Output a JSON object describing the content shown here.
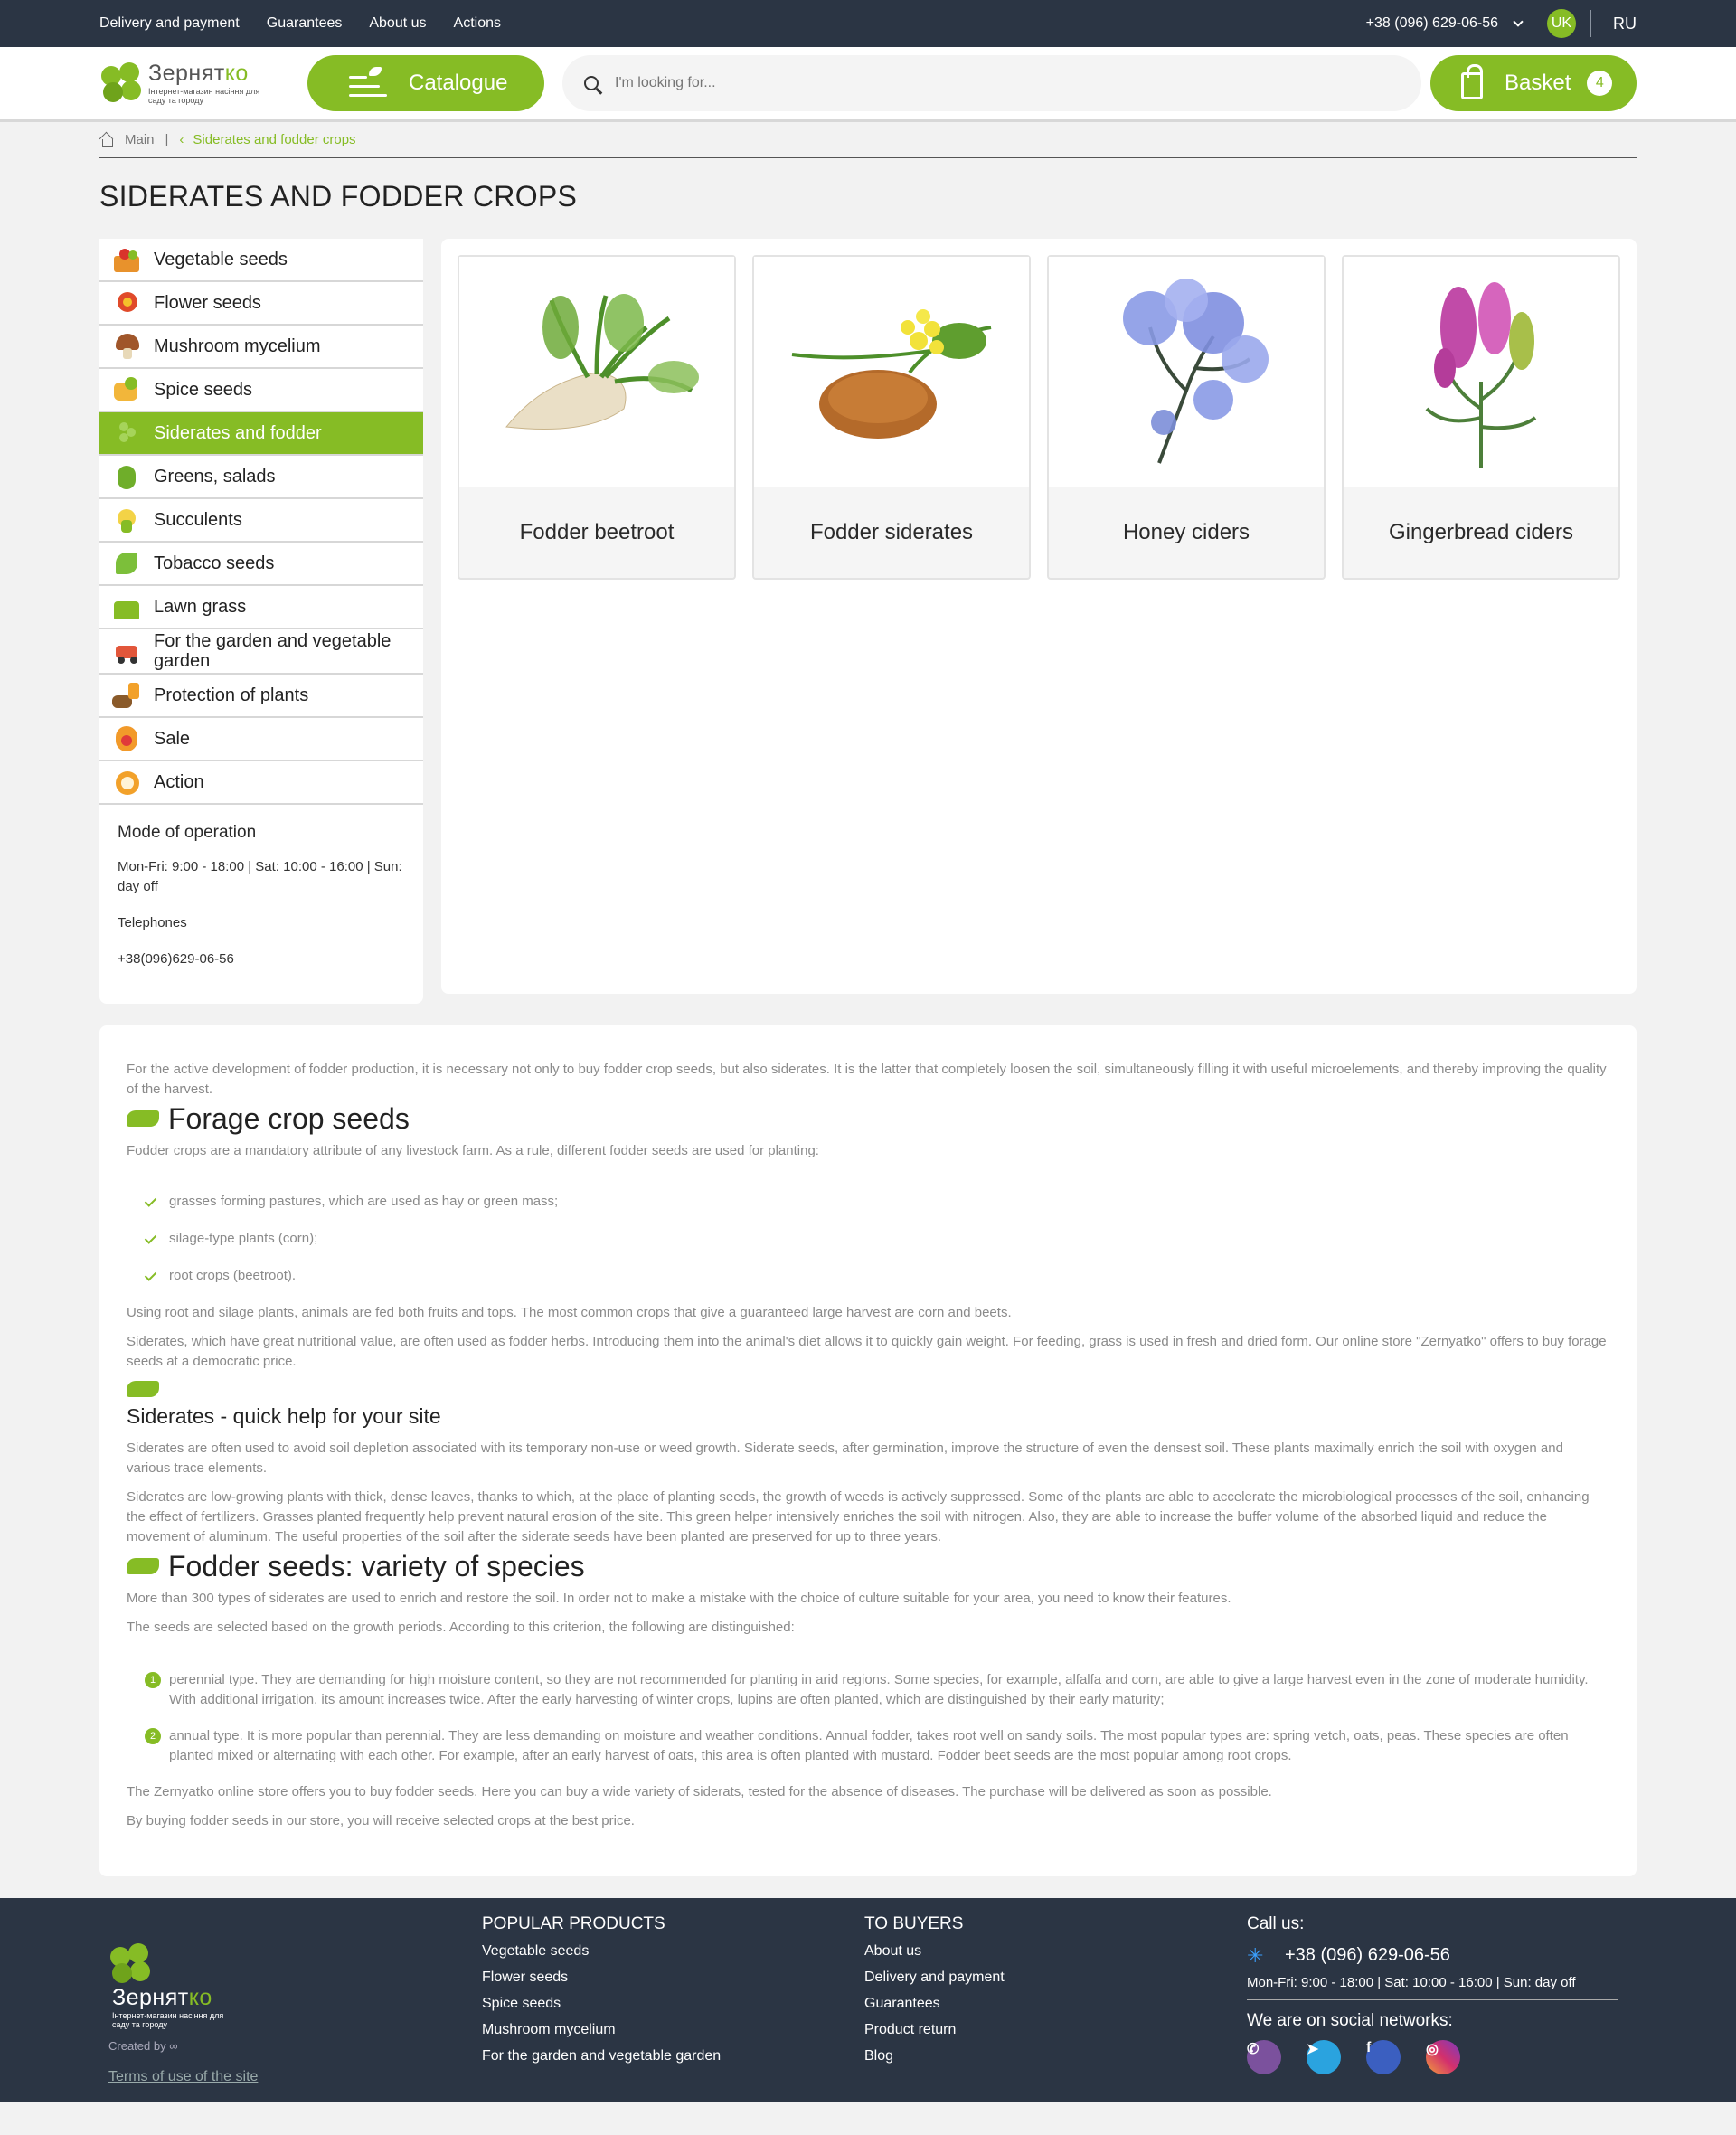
{
  "topbar": {
    "nav": [
      "Delivery and payment",
      "Guarantees",
      "About us",
      "Actions"
    ],
    "phone": "+38 (096) 629-06-56",
    "lang_active": "UK",
    "lang_other": "RU"
  },
  "header": {
    "logo_name": "Зернят",
    "logo_name_accent": "ко",
    "logo_sub": "Інтернет-магазин насіння для саду та городу",
    "catalogue": "Catalogue",
    "search_placeholder": "I'm looking for...",
    "basket": "Basket",
    "basket_count": "4"
  },
  "breadcrumb": {
    "home": "Main",
    "current": "Siderates and fodder crops"
  },
  "page_title": "SIDERATES AND FODDER CROPS",
  "sidebar": {
    "categories": [
      {
        "label": "Vegetable seeds",
        "icon": "vegetable-basket-icon"
      },
      {
        "label": "Flower seeds",
        "icon": "flower-icon"
      },
      {
        "label": "Mushroom mycelium",
        "icon": "mushroom-icon"
      },
      {
        "label": "Spice seeds",
        "icon": "spice-icon"
      },
      {
        "label": "Siderates and fodder",
        "icon": "clover-icon",
        "active": true
      },
      {
        "label": "Greens, salads",
        "icon": "greens-icon"
      },
      {
        "label": "Succulents",
        "icon": "succulent-icon"
      },
      {
        "label": "Tobacco seeds",
        "icon": "tobacco-leaf-icon"
      },
      {
        "label": "Lawn grass",
        "icon": "grass-icon"
      },
      {
        "label": "For the garden and vegetable garden",
        "icon": "lawnmower-icon"
      },
      {
        "label": "Protection of plants",
        "icon": "sprayer-icon"
      },
      {
        "label": "Sale",
        "icon": "sale-icon"
      },
      {
        "label": "Action",
        "icon": "action-badge-icon"
      }
    ],
    "mode_title": "Mode of operation",
    "mode_text": "Mon-Fri: 9:00 - 18:00 | Sat: 10:00 - 16:00 | Sun: day off",
    "phones_title": "Telephones",
    "phone": "+38(096)629-06-56"
  },
  "products": [
    {
      "title": "Fodder beetroot"
    },
    {
      "title": "Fodder siderates"
    },
    {
      "title": "Honey ciders"
    },
    {
      "title": "Gingerbread ciders"
    }
  ],
  "seo": {
    "intro": "For the active development of fodder production, it is necessary not only to buy fodder crop seeds, but also siderates. It is the latter that completely loosen the soil, simultaneously filling it with useful microelements, and thereby improving the quality of the harvest.",
    "h2_1": "Forage crop seeds",
    "p1": "Fodder crops are a mandatory attribute of any livestock farm. As a rule, different fodder seeds are used for planting:",
    "checks": [
      "grasses forming pastures, which are used as hay or green mass;",
      "silage-type plants (corn);",
      "root crops (beetroot)."
    ],
    "p2": "Using root and silage plants, animals are fed both fruits and tops. The most common crops that give a guaranteed large harvest are corn and beets.",
    "p3": "Siderates, which have great nutritional value, are often used as fodder herbs. Introducing them into the animal's diet allows it to quickly gain weight. For feeding, grass is used in fresh and dried form. Our online store \"Zernyatko\" offers to buy forage seeds at a democratic price.",
    "h3": "Siderates - quick help for your site",
    "p4": "Siderates are often used to avoid soil depletion associated with its temporary non-use or weed growth. Siderate seeds, after germination, improve the structure of even the densest soil. These plants maximally enrich the soil with oxygen and various trace elements.",
    "p5": "Siderates are low-growing plants with thick, dense leaves, thanks to which, at the place of planting seeds, the growth of weeds is actively suppressed. Some of the plants are able to accelerate the microbiological processes of the soil, enhancing the effect of fertilizers. Grasses planted frequently help prevent natural erosion of the site. This green helper intensively enriches the soil with nitrogen. Also, they are able to increase the buffer volume of the absorbed liquid and reduce the movement of aluminum. The useful properties of the soil after the siderate seeds have been planted are preserved for up to three years.",
    "h2_2": "Fodder seeds: variety of species",
    "p6": "More than 300 types of siderates are used to enrich and restore the soil. In order not to make a mistake with the choice of culture suitable for your area, you need to know their features.",
    "p7": "The seeds are selected based on the growth periods. According to this criterion, the following are distinguished:",
    "numbered": [
      {
        "n": "1",
        "text": "perennial type. They are demanding for high moisture content, so they are not recommended for planting in arid regions. Some species, for example, alfalfa and corn, are able to give a large harvest even in the zone of moderate humidity. With additional irrigation, its amount increases twice. After the early harvesting of winter crops, lupins are often planted, which are distinguished by their early maturity;"
      },
      {
        "n": "2",
        "text": "annual type. It is more popular than perennial. They are less demanding on moisture and weather conditions. Annual fodder, takes root well on sandy soils. The most popular types are: spring vetch, oats, peas. These species are often planted mixed or alternating with each other. For example, after an early harvest of oats, this area is often planted with mustard. Fodder beet seeds are the most popular among root crops."
      }
    ],
    "p8": "The Zernyatko online store offers you to buy fodder seeds. Here you can buy a wide variety of siderats, tested for the absence of diseases. The purchase will be delivered as soon as possible.",
    "p9": "By buying fodder seeds in our store, you will receive selected crops at the best price."
  },
  "footer": {
    "created_by": "Created by",
    "terms": "Terms of use of the site",
    "popular_title": "POPULAR PRODUCTS",
    "popular": [
      "Vegetable seeds",
      "Flower seeds",
      "Spice seeds",
      "Mushroom mycelium",
      "For the garden and vegetable garden"
    ],
    "buyers_title": "TO BUYERS",
    "buyers": [
      "About us",
      "Delivery and payment",
      "Guarantees",
      "Product return",
      "Blog"
    ],
    "call_title": "Call us:",
    "phone": "+38 (096) 629-06-56",
    "hours": "Mon-Fri: 9:00 - 18:00 | Sat: 10:00 - 16:00 | Sun: day off",
    "social_title": "We are on social networks:",
    "social": [
      "viber-icon",
      "telegram-icon",
      "facebook-icon",
      "instagram-icon"
    ]
  },
  "colors": {
    "accent": "#86bc25",
    "dark": "#2b3544"
  }
}
